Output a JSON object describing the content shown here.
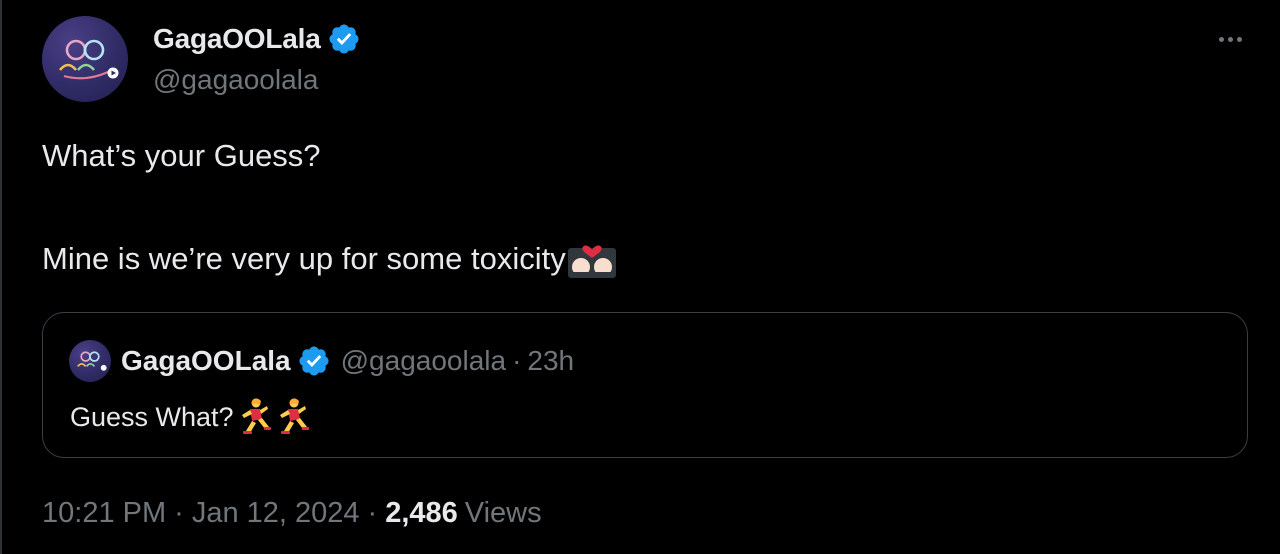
{
  "tweet": {
    "author": {
      "display_name": "GagaOOLala",
      "handle": "@gagaoolala",
      "verified": true,
      "avatar_icon": "gagaoolala-logo-icon"
    },
    "text_line1": "What’s your Guess?",
    "text_line2": "Mine is we’re very up for some toxicity",
    "text_line2_emoji": "kiss-emoji",
    "quoted": {
      "display_name": "GagaOOLala",
      "handle": "@gagaoolala",
      "separator": "·",
      "time": "23h",
      "text": "Guess What?",
      "emojis": [
        "woman-running-icon",
        "woman-running-icon"
      ]
    },
    "meta": {
      "time": "10:21 PM",
      "separator": "·",
      "date": "Jan 12, 2024",
      "views_count": "2,486",
      "views_label": "Views"
    }
  },
  "colors": {
    "background": "#000000",
    "text_primary": "#e7e9ea",
    "text_secondary": "#71767b",
    "verified_blue": "#1d9bf0",
    "border": "#3b3f43"
  }
}
